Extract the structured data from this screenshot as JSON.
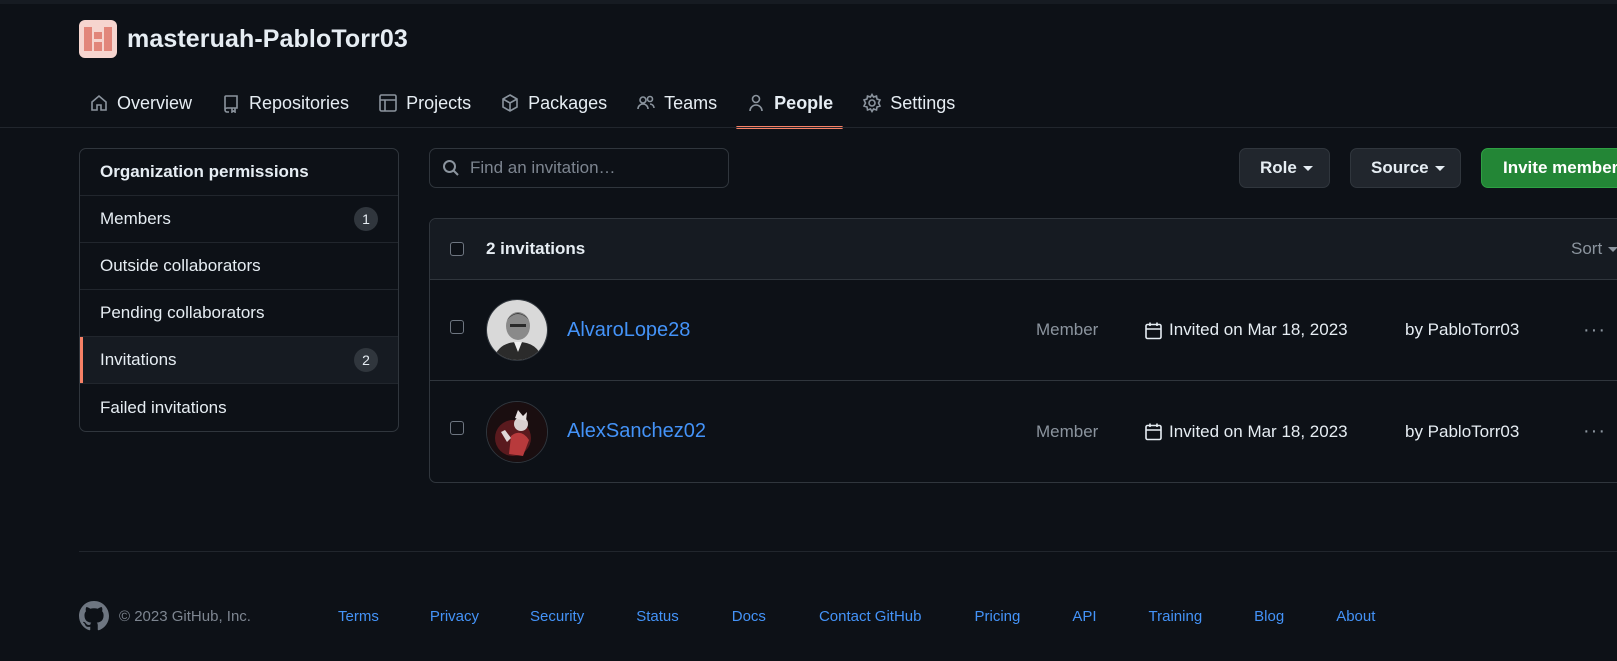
{
  "org": {
    "name": "masteruah-PabloTorr03"
  },
  "nav": {
    "items": [
      {
        "label": "Overview",
        "icon": "home-icon"
      },
      {
        "label": "Repositories",
        "icon": "repo-icon"
      },
      {
        "label": "Projects",
        "icon": "table-icon"
      },
      {
        "label": "Packages",
        "icon": "package-icon"
      },
      {
        "label": "Teams",
        "icon": "people-icon"
      },
      {
        "label": "People",
        "icon": "person-icon",
        "active": true
      },
      {
        "label": "Settings",
        "icon": "gear-icon"
      }
    ]
  },
  "sidebar": {
    "heading": "Organization permissions",
    "items": [
      {
        "label": "Members",
        "count": "1"
      },
      {
        "label": "Outside collaborators"
      },
      {
        "label": "Pending collaborators"
      },
      {
        "label": "Invitations",
        "count": "2",
        "selected": true
      },
      {
        "label": "Failed invitations"
      }
    ]
  },
  "toolbar": {
    "search_placeholder": "Find an invitation…",
    "role_label": "Role",
    "source_label": "Source",
    "invite_label": "Invite member"
  },
  "table": {
    "count_label": "2 invitations",
    "sort_label": "Sort",
    "rows": [
      {
        "login": "AlvaroLope28",
        "role": "Member",
        "invited": "Invited on Mar 18, 2023",
        "by": "by PabloTorr03"
      },
      {
        "login": "AlexSanchez02",
        "role": "Member",
        "invited": "Invited on Mar 18, 2023",
        "by": "by PabloTorr03"
      }
    ]
  },
  "footer": {
    "copyright": "© 2023 GitHub, Inc.",
    "links": [
      "Terms",
      "Privacy",
      "Security",
      "Status",
      "Docs",
      "Contact GitHub",
      "Pricing",
      "API",
      "Training",
      "Blog",
      "About"
    ]
  },
  "colors": {
    "accent": "#f78166",
    "link": "#4493f8",
    "primary_button": "#238636",
    "background": "#0d1117"
  }
}
